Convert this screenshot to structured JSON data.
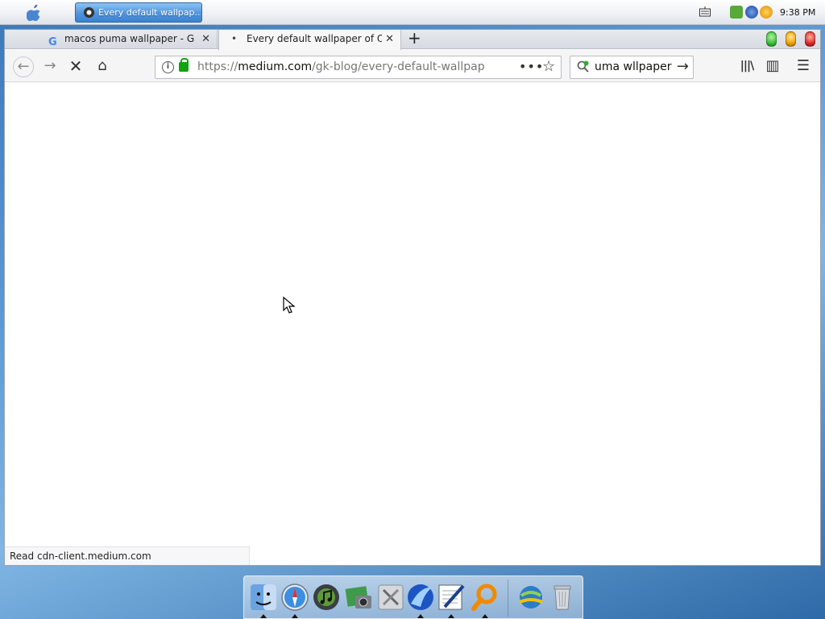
{
  "menubar": {
    "task_button_label": "Every default wallpap...",
    "clock": "9:38 PM"
  },
  "tabs": [
    {
      "title": "macos puma wallpaper - G",
      "favicon": "G",
      "close": "✕"
    },
    {
      "title": "Every default wallpaper of O",
      "close": "✕",
      "loading_indicator": "•"
    }
  ],
  "new_tab_label": "+",
  "nav": {
    "back": "←",
    "forward": "→",
    "stop": "✕",
    "home": "⌂"
  },
  "url": {
    "prefix": "https://",
    "host": "medium.com",
    "path": "/gk-blog/every-default-wallpap",
    "info_glyph": "i",
    "more_glyph": "•••",
    "bookmark_glyph": "☆"
  },
  "search": {
    "value": "uma wllpaper",
    "go_glyph": "→"
  },
  "toolbar": {
    "library_glyph": "|||\\",
    "sidebar_glyph": "▥",
    "menu_glyph": "☰"
  },
  "status": "Read cdn-client.medium.com",
  "colors": {
    "traffic_green": "#3cc23c",
    "traffic_yellow": "#f0a400",
    "traffic_red": "#e03030",
    "lock_green": "#12a312"
  },
  "dock_icons": [
    "finder-icon",
    "safari-icon",
    "itunes-icon",
    "iphoto-icon",
    "system-preferences-icon",
    "mail-icon",
    "textedit-icon",
    "search-icon",
    "network-icon",
    "trash-icon"
  ]
}
